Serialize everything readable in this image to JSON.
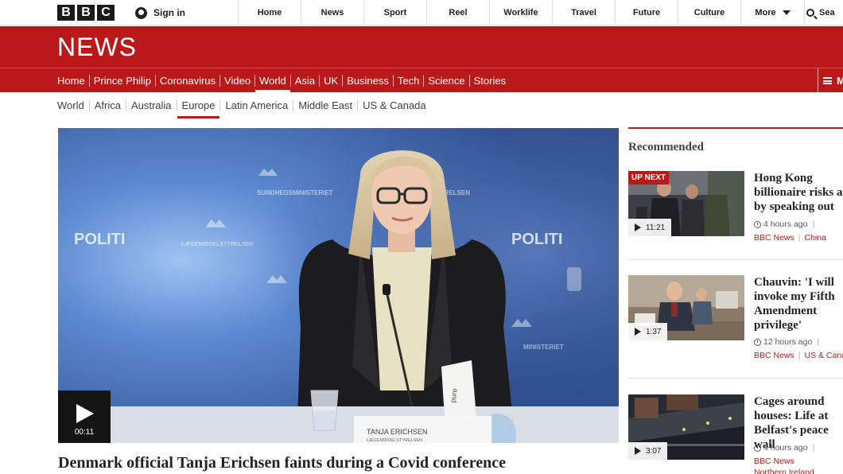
{
  "brand": {
    "letters": [
      "B",
      "B",
      "C"
    ],
    "section": "NEWS"
  },
  "topbar": {
    "signin_label": "Sign in",
    "nav": [
      "Home",
      "News",
      "Sport",
      "Reel",
      "Worklife",
      "Travel",
      "Future",
      "Culture"
    ],
    "more_label": "More",
    "search_label": "Sea"
  },
  "section_nav": {
    "items": [
      "Home",
      "Prince Philip",
      "Coronavirus",
      "Video",
      "World",
      "Asia",
      "UK",
      "Business",
      "Tech",
      "Science",
      "Stories"
    ],
    "active": "World",
    "menu_label": "M"
  },
  "sub_nav": {
    "items": [
      "World",
      "Africa",
      "Australia",
      "Europe",
      "Latin America",
      "Middle East",
      "US & Canada"
    ],
    "active": "Europe"
  },
  "main_video": {
    "duration": "00:11",
    "headline": "Denmark official Tanja Erichsen faints during a Covid conference",
    "backdrop_texts": [
      "POLITI",
      "POLITI",
      "SUNDHEDSMINISTERIET",
      "LÆGEMIDDELSTYRELSEN",
      "STYRELSEN",
      "MINISTERIET"
    ],
    "nameplate": {
      "name": "TANJA ERICHSEN",
      "org": "LÆGEMIDDELSTYRELSEN"
    },
    "carton_text": "pure"
  },
  "recommended": {
    "title": "Recommended",
    "items": [
      {
        "badge": "UP NEXT",
        "duration": "11:21",
        "title": "Hong Kong billionaire risks all by speaking out",
        "time": "4 hours ago",
        "tags": [
          "BBC News",
          "China"
        ]
      },
      {
        "badge": "",
        "duration": "1:37",
        "title": "Chauvin: 'I will invoke my Fifth Amendment privilege'",
        "time": "12 hours ago",
        "tags": [
          "BBC News",
          "US & Canada"
        ]
      },
      {
        "badge": "",
        "duration": "3:07",
        "title": "Cages around houses: Life at Belfast's peace wall",
        "time": "4 hours ago",
        "tags": [
          "BBC News",
          "Northern Ireland"
        ]
      }
    ]
  },
  "colors": {
    "accent": "#bb1919",
    "logo_bg": "#1a1a1a",
    "text": "#222222"
  }
}
